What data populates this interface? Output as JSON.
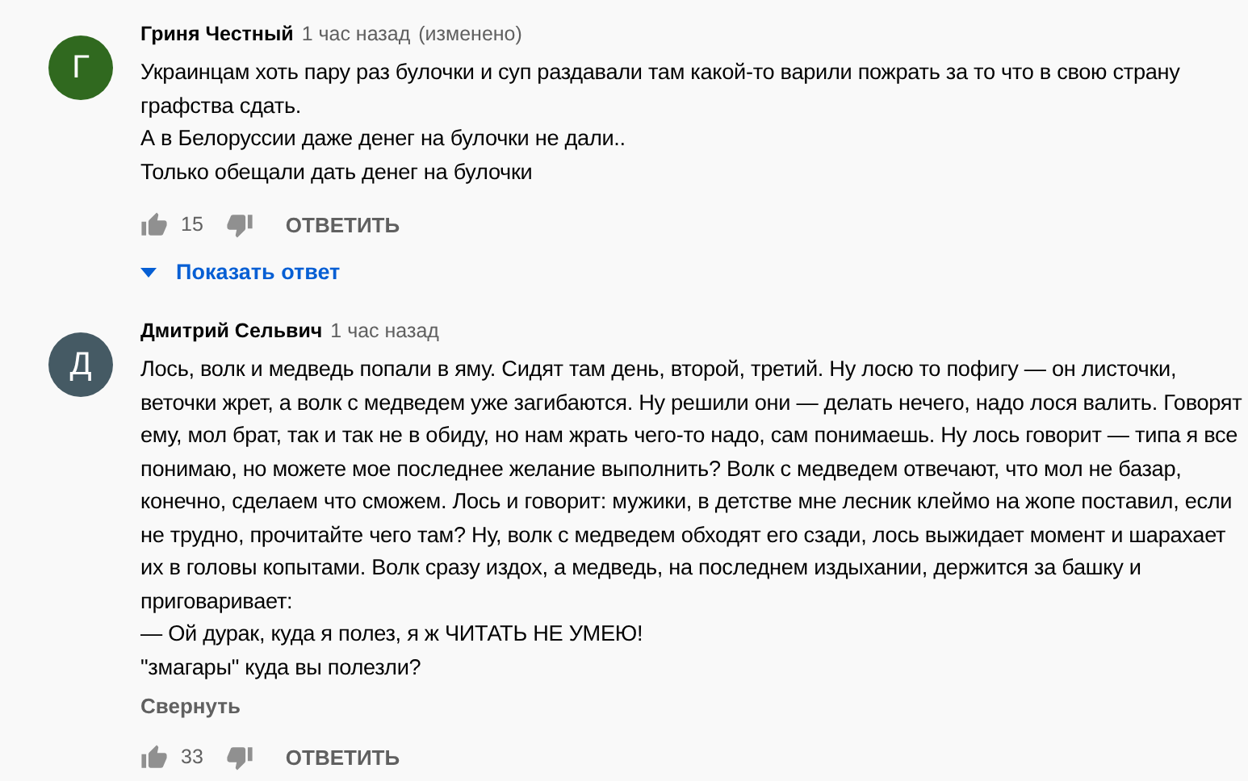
{
  "comments": [
    {
      "avatar_letter": "Г",
      "color": "#30691f",
      "author": "Гриня Честный",
      "time": "1 час назад",
      "edited": "(изменено)",
      "paragraphs": [
        "Украинцам хоть пару раз булочки и суп раздавали там какой-то варили пожрать за то что в свою страну графства сдать.",
        "А в Белоруссии даже денег на булочки не дали..",
        "Только обещали дать денег на булочки"
      ],
      "likes": "15",
      "reply": "ОТВЕТИТЬ",
      "show_replies": "Показать ответ"
    },
    {
      "avatar_letter": "Д",
      "color": "#455a64",
      "author": "Дмитрий Сельвич",
      "time": "1 час назад",
      "paragraphs": [
        "Лось, волк и медведь попали в яму. Сидят там день, второй, третий. Ну лосю то пофигу — он листочки, веточки жрет, а волк с медведем уже загибаются. Ну решили они — делать нечего, надо лося валить. Говорят ему, мол брат, так и так не в обиду, но нам жрать чего-то надо, сам понимаешь. Ну лось говорит — типа я все понимаю, но можете мое последнее желание выполнить? Волк с медведем отвечают, что мол не базар, конечно, сделаем что сможем. Лось и говорит: мужики, в детстве мне лесник клеймо на жопе поставил, если не трудно, прочитайте чего там? Ну, волк с медведем обходят его сзади, лось выжидает момент и шарахает их в головы копытами. Волк сразу издох, а медведь, на последнем издыхании, держится за башку и приговаривает:",
        "— Ой дурак, куда я полез, я ж ЧИТАТЬ НЕ УМЕЮ!",
        "\"змагары\" куда вы полезли?"
      ],
      "collapse": "Свернуть",
      "likes": "33",
      "reply": "ОТВЕТИТЬ"
    }
  ]
}
